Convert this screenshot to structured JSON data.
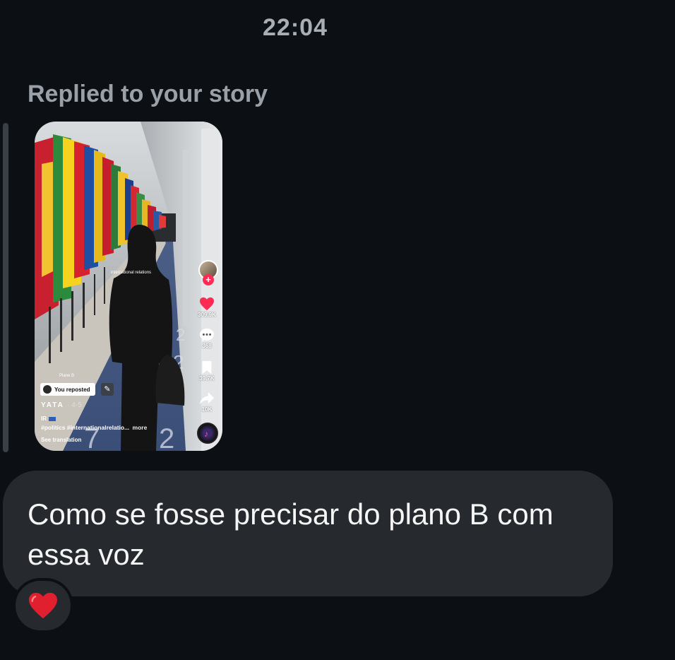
{
  "header": {
    "time": "22:04"
  },
  "reply": {
    "label": "Replied to your story"
  },
  "story": {
    "overlay_caption": "international relations",
    "likes": "309.9K",
    "comments": "368",
    "saves": "39.7K",
    "shares": "10K",
    "plane_label": "Plane B",
    "repost_label": "You reposted",
    "author": "YATA",
    "date": "· 4-5",
    "post_text": "IR",
    "hashtags": "#politics #internationalrelatio...",
    "more_label": "more",
    "see_translation": "See translation",
    "accent": "#fe2c55"
  },
  "message": {
    "text": "Como se fosse precisar do plano B com essa voz",
    "bubble_color": "#262a2f"
  },
  "reaction": {
    "icon": "heart-emoji",
    "color": "#e0202e"
  }
}
